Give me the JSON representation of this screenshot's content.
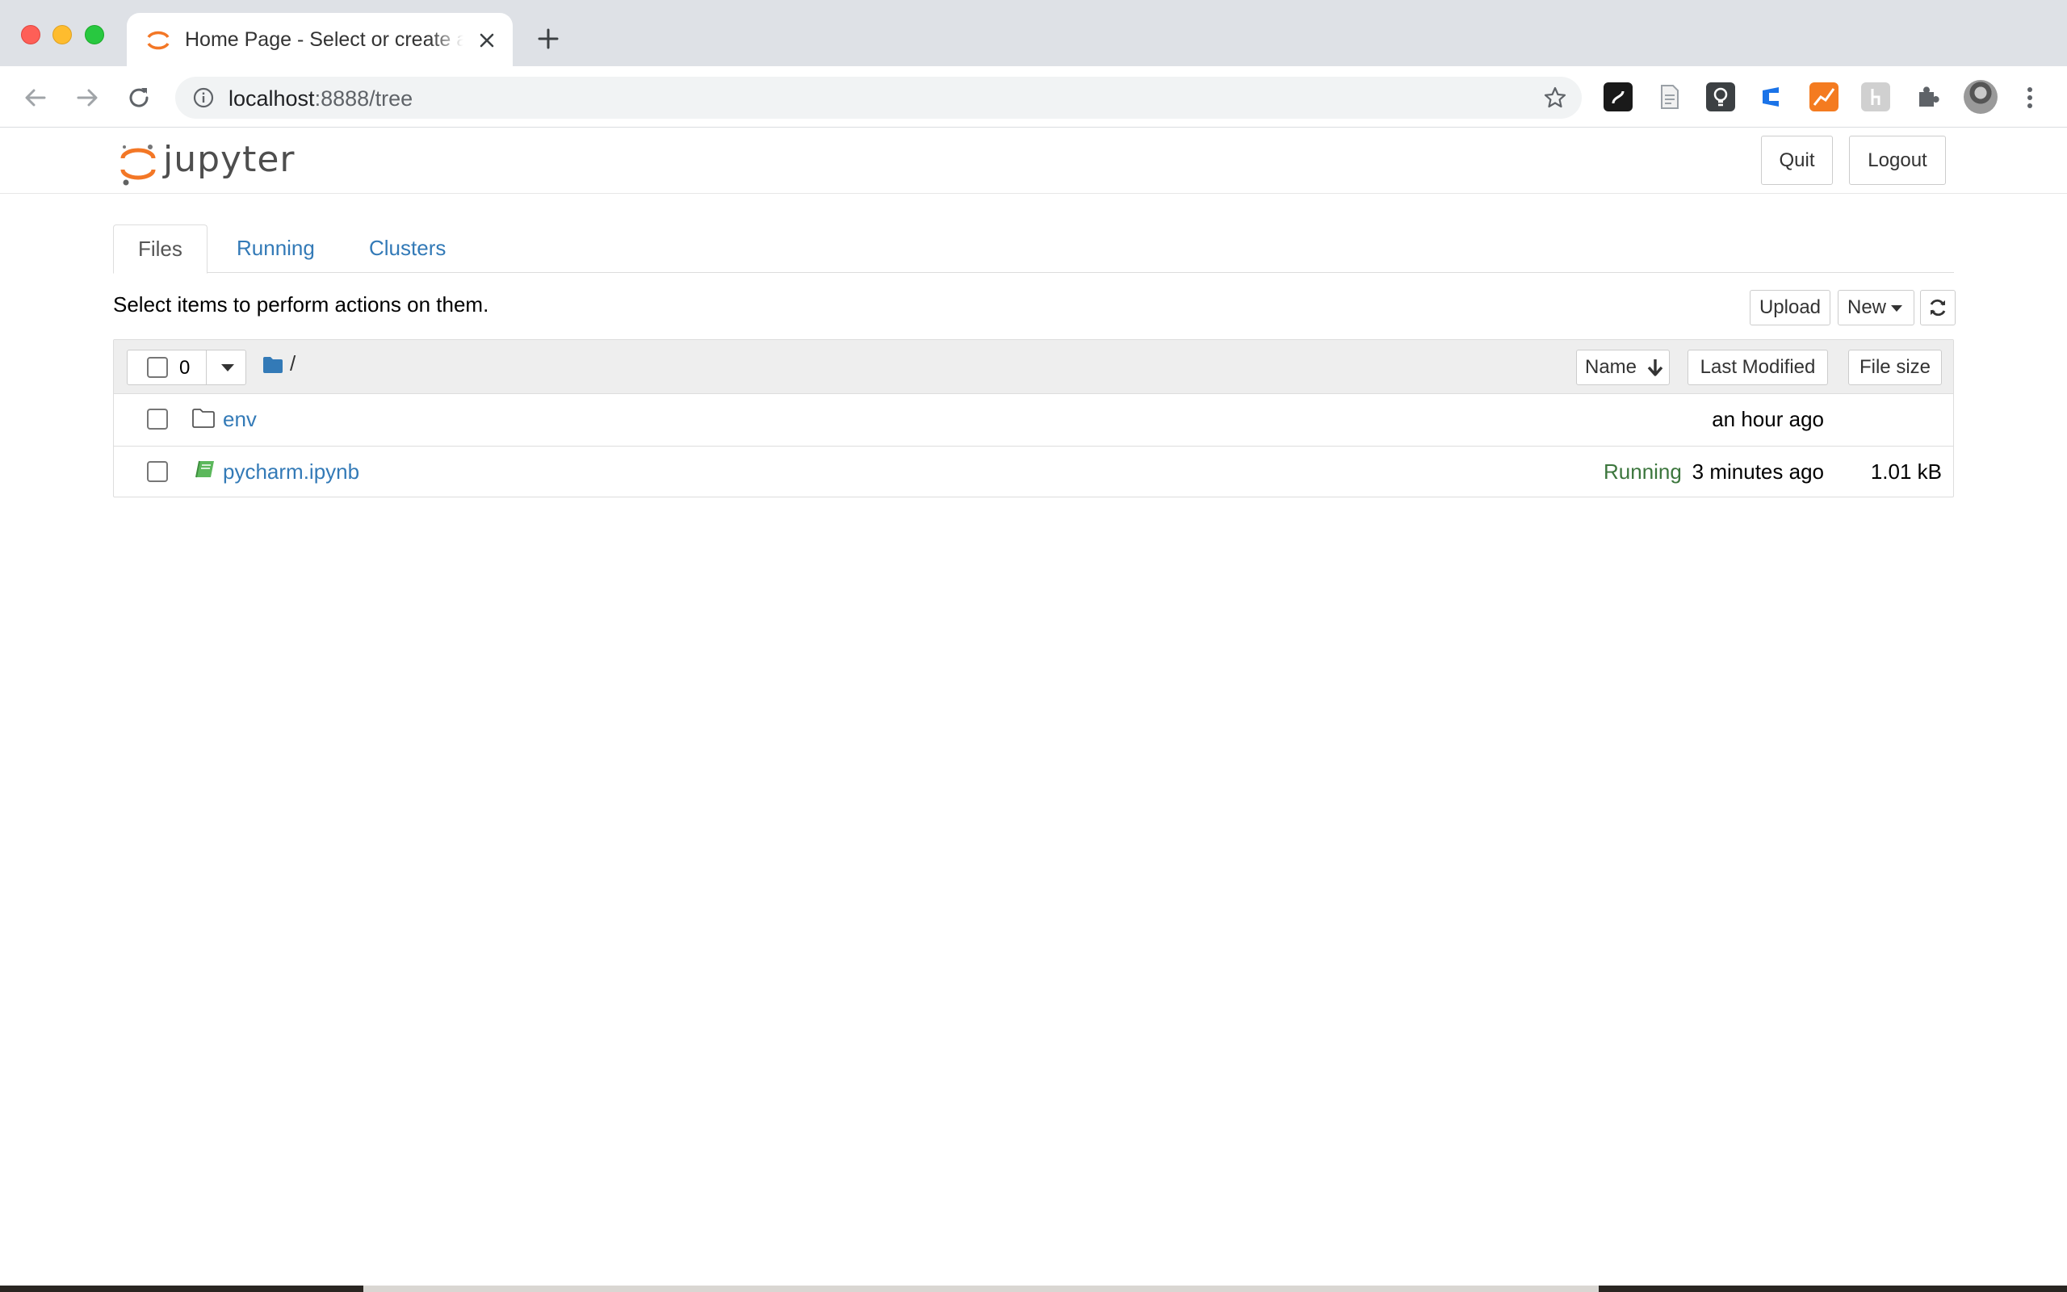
{
  "browser": {
    "tab_title": "Home Page - Select or create a notebook",
    "url_host": "localhost",
    "url_rest": ":8888/tree",
    "colors": {
      "tabstrip": "#dee1e6",
      "omnibox": "#f1f3f4"
    }
  },
  "header": {
    "logo_text": "jupyter",
    "quit_label": "Quit",
    "logout_label": "Logout"
  },
  "tabs": [
    {
      "label": "Files",
      "active": true
    },
    {
      "label": "Running",
      "active": false
    },
    {
      "label": "Clusters",
      "active": false
    }
  ],
  "toolbar": {
    "hint": "Select items to perform actions on them.",
    "upload_label": "Upload",
    "new_label": "New",
    "refresh_icon": "refresh-icon"
  },
  "list": {
    "selected_count": "0",
    "breadcrumb_sep": "/",
    "columns": {
      "name": "Name",
      "modified": "Last Modified",
      "size": "File size"
    },
    "rows": [
      {
        "name": "env",
        "kind": "folder",
        "status": "",
        "modified": "an hour ago",
        "size": ""
      },
      {
        "name": "pycharm.ipynb",
        "kind": "notebook",
        "status": "Running",
        "modified": "3 minutes ago",
        "size": "1.01 kB"
      }
    ]
  },
  "colors": {
    "link": "#337ab7",
    "running": "#3c763d",
    "jupyter_orange": "#f37726",
    "notebook_green": "#5cb85c"
  }
}
